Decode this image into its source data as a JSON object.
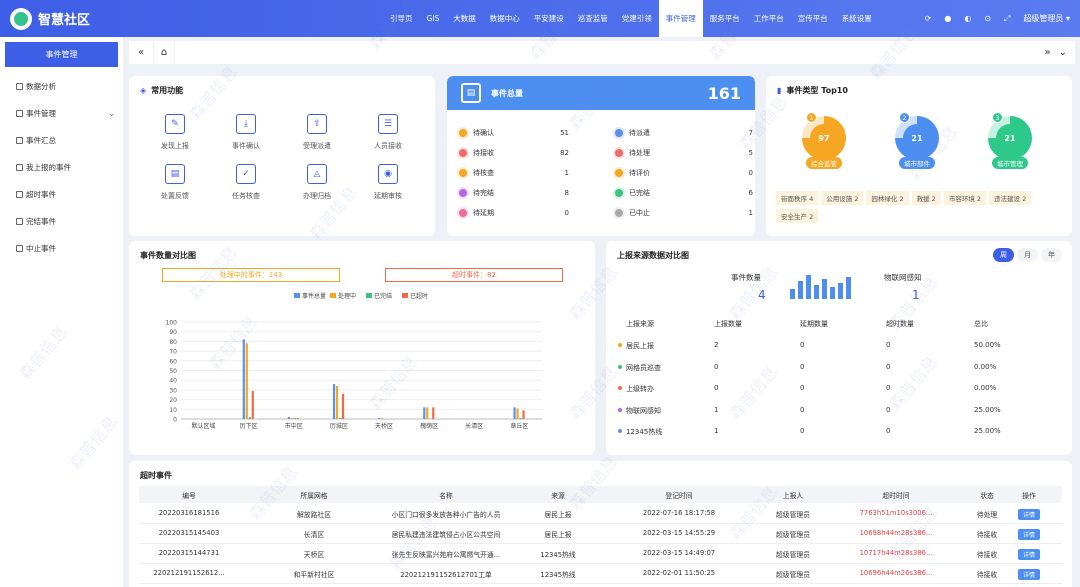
{
  "app": {
    "name": "智慧社区"
  },
  "nav": [
    "引导页",
    "GIS",
    "大数据",
    "数据中心",
    "平安建设",
    "巡查监管",
    "党建引领",
    "事件管理",
    "服务平台",
    "工作平台",
    "宣传平台",
    "系统设置"
  ],
  "nav_active_index": 7,
  "user": {
    "name": "超级管理员"
  },
  "sidebar": {
    "header": "事件管理",
    "items": [
      "数据分析",
      "事件管理",
      "事件汇总",
      "我上报的事件",
      "超时事件",
      "完结事件",
      "中止事件"
    ]
  },
  "quick": {
    "title": "常用功能",
    "items": [
      {
        "label": "发现上报",
        "icon": "edit-icon"
      },
      {
        "label": "事件确认",
        "icon": "download-icon"
      },
      {
        "label": "受理派遣",
        "icon": "dispatch-icon"
      },
      {
        "label": "人员接收",
        "icon": "receive-icon"
      },
      {
        "label": "处置反馈",
        "icon": "feedback-icon"
      },
      {
        "label": "任务核查",
        "icon": "check-icon"
      },
      {
        "label": "办理归档",
        "icon": "archive-icon"
      },
      {
        "label": "延期审核",
        "icon": "review-icon"
      }
    ]
  },
  "summary": {
    "title": "事件总量",
    "total": "161",
    "left": [
      {
        "label": "待确认",
        "value": "51",
        "color": "#f5a623"
      },
      {
        "label": "待接收",
        "value": "82",
        "color": "#f06a6a"
      },
      {
        "label": "待核查",
        "value": "1",
        "color": "#f5a623"
      },
      {
        "label": "待完结",
        "value": "8",
        "color": "#b463e6"
      },
      {
        "label": "待延期",
        "value": "0",
        "color": "#f06a9a"
      }
    ],
    "right": [
      {
        "label": "待派遣",
        "value": "7",
        "color": "#5b8ff0"
      },
      {
        "label": "待处理",
        "value": "5",
        "color": "#f06a6a"
      },
      {
        "label": "待评价",
        "value": "0",
        "color": "#f5a623"
      },
      {
        "label": "已完结",
        "value": "6",
        "color": "#3cc57b"
      },
      {
        "label": "已中止",
        "value": "1",
        "color": "#aaaaaa"
      }
    ]
  },
  "types": {
    "title": "事件类型 Top10",
    "top": [
      {
        "rank": "1",
        "value": "97",
        "label": "综合监管",
        "color": "#f5a623"
      },
      {
        "rank": "2",
        "value": "21",
        "label": "城市部件",
        "color": "#4c8ff0"
      },
      {
        "rank": "3",
        "value": "21",
        "label": "城市管理",
        "color": "#2cc98a"
      }
    ],
    "tags": [
      "街面秩序 4",
      "公用设施 2",
      "园林绿化 2",
      "救援 2",
      "市容环境 2",
      "违法建设 2",
      "安全生产 2"
    ]
  },
  "compare": {
    "title": "事件数量对比图",
    "processing_label": "处理中的事件：143",
    "overdue_label": "超时事件：82"
  },
  "chart_data": {
    "type": "bar",
    "title": "",
    "categories": [
      "默认区域",
      "历下区",
      "市中区",
      "历城区",
      "天桥区",
      "槐荫区",
      "长清区",
      "章丘区"
    ],
    "series": [
      {
        "name": "事件总量",
        "color": "#5b8ff0",
        "values": [
          0,
          82,
          2,
          36,
          1,
          12,
          0,
          12
        ]
      },
      {
        "name": "处理中",
        "color": "#f5a623",
        "values": [
          0,
          78,
          1,
          34,
          1,
          12,
          0,
          11
        ]
      },
      {
        "name": "已完结",
        "color": "#3cc57b",
        "values": [
          0,
          2,
          1,
          1,
          0,
          0,
          0,
          1
        ]
      },
      {
        "name": "已超时",
        "color": "#f06a4a",
        "values": [
          0,
          29,
          1,
          26,
          0,
          12,
          0,
          9
        ]
      }
    ],
    "yticks": [
      "0",
      "10",
      "20",
      "30",
      "40",
      "50",
      "60",
      "70",
      "80",
      "90",
      "100"
    ],
    "ylim": [
      0,
      100
    ],
    "grid": true,
    "legend": "top"
  },
  "source": {
    "title": "上报来源数据对比图",
    "toggles": [
      "周",
      "月",
      "年"
    ],
    "event_count_label": "事件数量",
    "event_count": "4",
    "iot_label": "物联网感知",
    "iot_count": "1",
    "mini_bars": [
      10,
      18,
      24,
      14,
      20,
      12,
      16,
      22
    ],
    "headers": [
      "上报来源",
      "上报数量",
      "延期数量",
      "超时数量",
      "总比"
    ],
    "rows": [
      {
        "name": "居民上报",
        "count": "2",
        "delay": "0",
        "overdue": "0",
        "ratio": "50.00%",
        "color": "#f5a623"
      },
      {
        "name": "网格员巡查",
        "count": "0",
        "delay": "0",
        "overdue": "0",
        "ratio": "0.00%",
        "color": "#3cc57b"
      },
      {
        "name": "上级转办",
        "count": "0",
        "delay": "0",
        "overdue": "0",
        "ratio": "0.00%",
        "color": "#f06a4a"
      },
      {
        "name": "物联网感知",
        "count": "1",
        "delay": "0",
        "overdue": "0",
        "ratio": "25.00%",
        "color": "#b463e6"
      },
      {
        "name": "12345热线",
        "count": "1",
        "delay": "0",
        "overdue": "0",
        "ratio": "25.00%",
        "color": "#5b8ff0"
      }
    ]
  },
  "overdue": {
    "title": "超时事件",
    "headers": [
      "编号",
      "所属网格",
      "名称",
      "来源",
      "登记时间",
      "上报人",
      "超时时间",
      "状态",
      "操作"
    ],
    "rows": [
      [
        "20220316181516",
        "解放路社区",
        "小区门口很多发放各种小广告的人员",
        "居民上报",
        "2022-07-16 18:17:58",
        "超级管理员",
        "7763h51m10s3006...",
        "待处理",
        "详情"
      ],
      [
        "20220315145403",
        "长清区",
        "居民私建违法建筑侵占小区公共空间",
        "居民上报",
        "2022-03-15 14:55:29",
        "超级管理员",
        "10698h44m28s386...",
        "待接收",
        "详情"
      ],
      [
        "20220315144731",
        "天桥区",
        "张先生反映富兴苑府公寓燃气开通...",
        "12345热线",
        "2022-03-15 14:49:07",
        "超级管理员",
        "10717h44m28s386...",
        "待接收",
        "详情"
      ],
      [
        "22021219115261​2...",
        "和平新村社区",
        "2202121911526127​01工单",
        "12345热线",
        "2022-02-01 11:50:25",
        "超级管理员",
        "10696h44m26s386...",
        "待接收",
        "详情"
      ]
    ]
  },
  "watermark_text": "森普信息"
}
